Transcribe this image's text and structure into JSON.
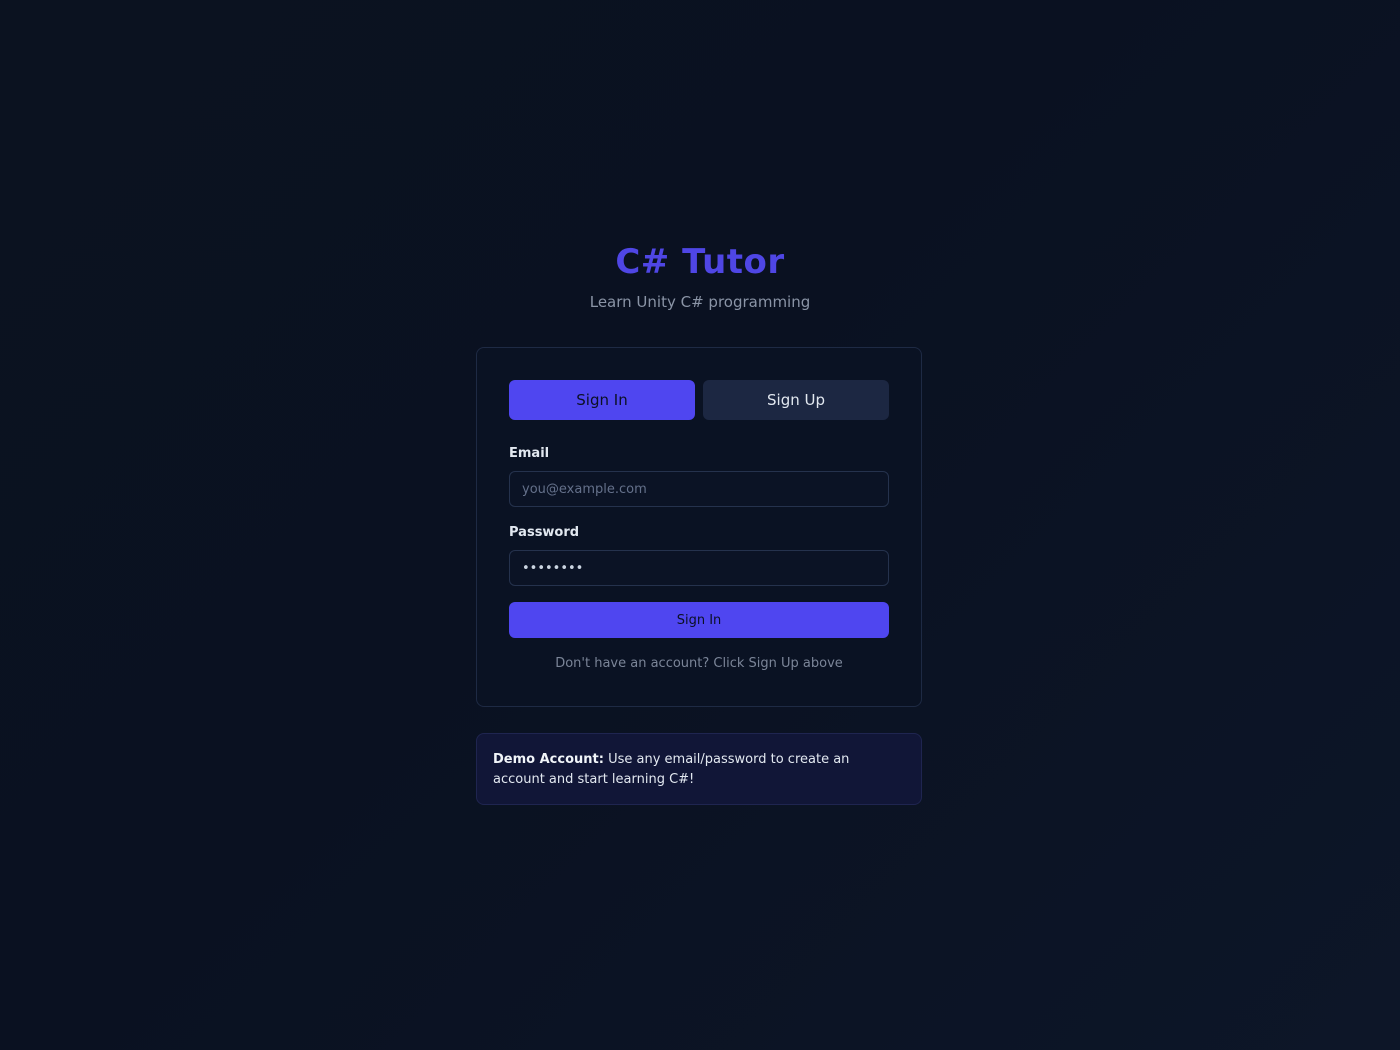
{
  "header": {
    "title": "C# Tutor",
    "subtitle": "Learn Unity C# programming"
  },
  "tabs": [
    {
      "label": "Sign In",
      "active": true
    },
    {
      "label": "Sign Up",
      "active": false
    }
  ],
  "form": {
    "email": {
      "label": "Email",
      "placeholder": "you@example.com",
      "value": ""
    },
    "password": {
      "label": "Password",
      "value": "••••••••"
    },
    "submit_label": "Sign In",
    "hint": "Don't have an account? Click Sign Up above"
  },
  "demo": {
    "label": "Demo Account:",
    "text": "Use any email/password to create an account and start learning C#!"
  },
  "colors": {
    "accent": "#4f46e5",
    "background": "#0b1220",
    "card": "#0a1223"
  }
}
